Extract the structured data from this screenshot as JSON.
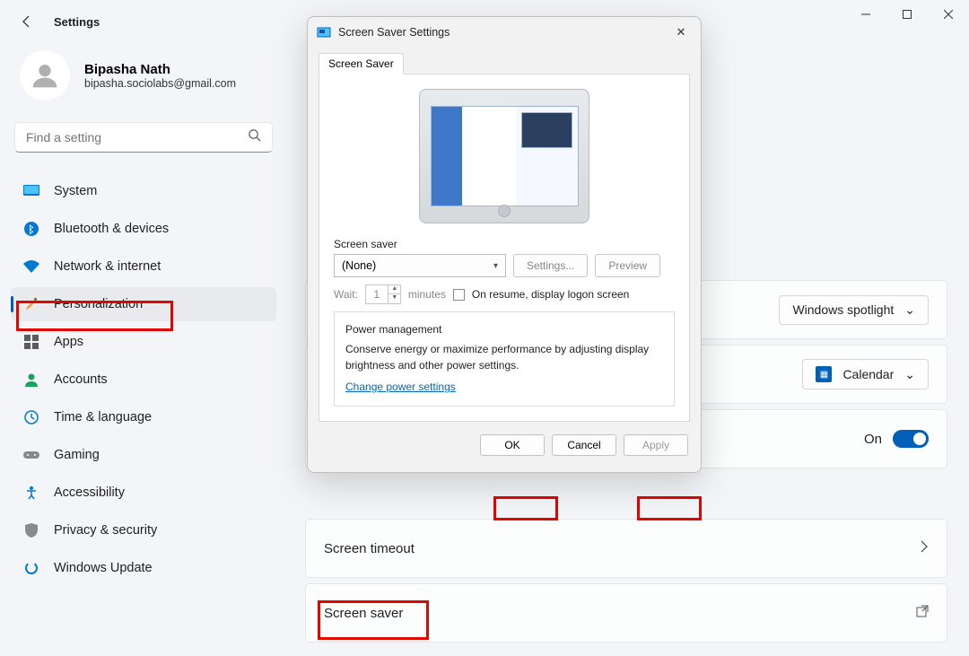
{
  "titlebar": {
    "title": "Settings"
  },
  "profile": {
    "name": "Bipasha Nath",
    "email": "bipasha.sociolabs@gmail.com"
  },
  "search": {
    "placeholder": "Find a setting"
  },
  "nav": {
    "system": "System",
    "bluetooth": "Bluetooth & devices",
    "network": "Network & internet",
    "personalization": "Personalization",
    "apps": "Apps",
    "accounts": "Accounts",
    "time": "Time & language",
    "gaming": "Gaming",
    "accessibility": "Accessibility",
    "privacy": "Privacy & security",
    "update": "Windows Update"
  },
  "main": {
    "spotlight_label": "Windows spotlight",
    "calendar_label": "Calendar",
    "toggle_label": "On",
    "screen_timeout": "Screen timeout",
    "screen_saver": "Screen saver"
  },
  "dialog": {
    "title": "Screen Saver Settings",
    "tab": "Screen Saver",
    "group_label": "Screen saver",
    "selected": "(None)",
    "settings_btn": "Settings...",
    "preview_btn": "Preview",
    "wait_label": "Wait:",
    "wait_value": "1",
    "minutes": "minutes",
    "resume": "On resume, display logon screen",
    "pm_legend": "Power management",
    "pm_text": "Conserve energy or maximize performance by adjusting display brightness and other power settings.",
    "pm_link": "Change power settings",
    "ok": "OK",
    "cancel": "Cancel",
    "apply": "Apply"
  }
}
